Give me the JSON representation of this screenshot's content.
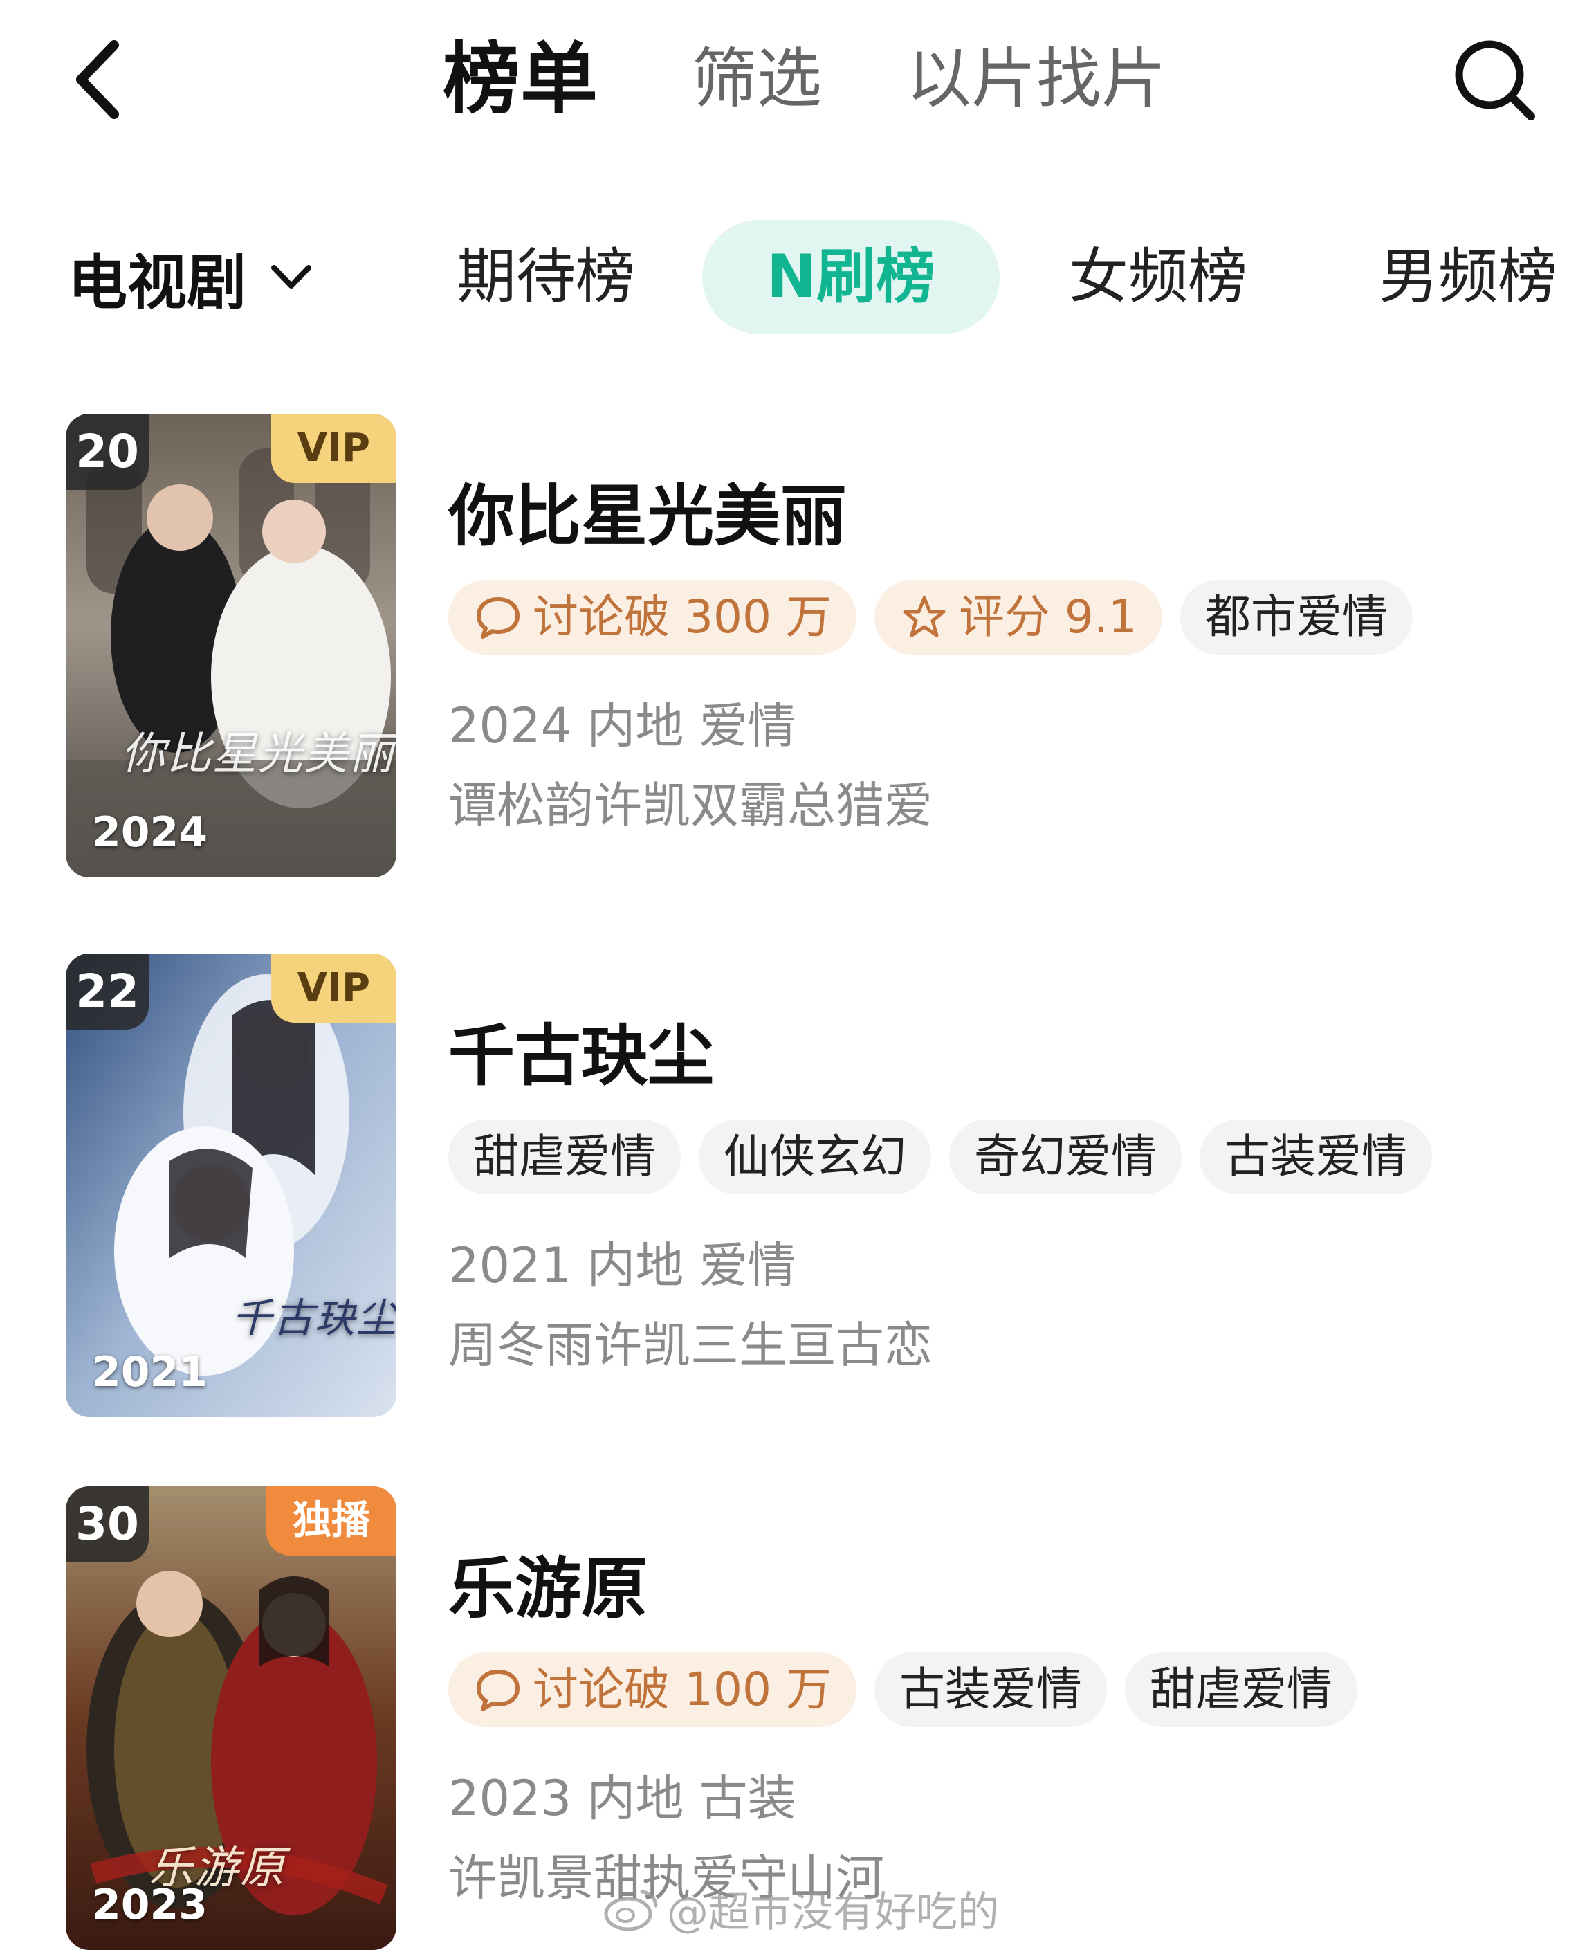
{
  "header": {
    "tabs": [
      "榜单",
      "筛选",
      "以片找片"
    ]
  },
  "filters": {
    "category": "电视剧",
    "tabs": [
      "期待榜",
      "N刷榜",
      "女频榜",
      "男频榜"
    ]
  },
  "items": [
    {
      "rank": "20",
      "badge": "VIP",
      "poster_year": "2024",
      "poster_caption": "你比星光美丽",
      "title": "你比星光美丽",
      "chips": [
        "讨论破 300 万",
        "评分 9.1",
        "都市爱情"
      ],
      "meta": "2024 内地 爱情",
      "desc": "谭松韵许凯双霸总猎爱"
    },
    {
      "rank": "22",
      "badge": "VIP",
      "poster_year": "2021",
      "poster_caption": "千古玦尘",
      "title": "千古玦尘",
      "chips": [
        "甜虐爱情",
        "仙侠玄幻",
        "奇幻爱情",
        "古装爱情"
      ],
      "meta": "2021 内地 爱情",
      "desc": "周冬雨许凯三生亘古恋"
    },
    {
      "rank": "30",
      "badge": "独播",
      "poster_year": "2023",
      "poster_caption": "乐游原",
      "title": "乐游原",
      "chips": [
        "讨论破 100 万",
        "古装爱情",
        "甜虐爱情"
      ],
      "meta": "2023 内地 古装",
      "desc": "许凯景甜执爱守山河"
    }
  ],
  "watermark": "@超市没有好吃的",
  "colors": {
    "active_tab_bg": "#e2f6f1",
    "active_tab_text": "#12b592",
    "vip_badge": "#f4d37c",
    "exclusive_badge": "#f08a3c",
    "highlight_chip_bg": "#fbefe3",
    "highlight_chip_text": "#c0733a"
  }
}
